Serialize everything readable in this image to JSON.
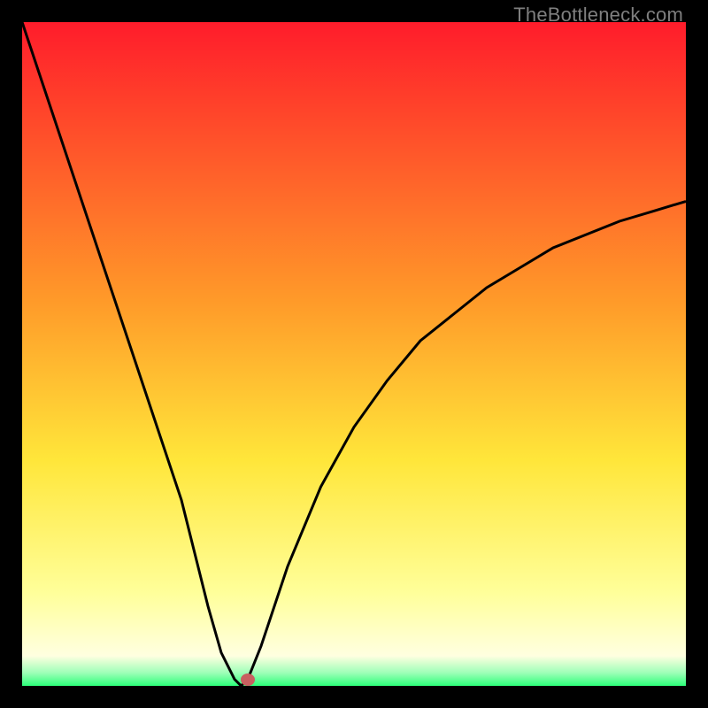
{
  "watermark": {
    "text": "TheBottleneck.com"
  },
  "colors": {
    "top": "#ff1c2b",
    "mid_orange": "#ff9a29",
    "yellow": "#ffe63a",
    "pale_yellow": "#ffff9a",
    "green": "#2cff7a",
    "curve": "#000000",
    "marker": "#c86060",
    "frame": "#000000"
  },
  "chart_data": {
    "type": "line",
    "title": "",
    "xlabel": "",
    "ylabel": "",
    "xlim": [
      0,
      100
    ],
    "ylim": [
      0,
      100
    ],
    "grid": false,
    "legend": false,
    "comment": "V-shaped bottleneck curve. Minimum near x≈33, y≈0. Axes unlabeled; values are percentage estimates read from proportional position.",
    "series": [
      {
        "name": "bottleneck-curve",
        "x": [
          0,
          4,
          8,
          12,
          16,
          20,
          24,
          28,
          30,
          32,
          33,
          34,
          36,
          40,
          45,
          50,
          55,
          60,
          65,
          70,
          75,
          80,
          85,
          90,
          95,
          100
        ],
        "y": [
          100,
          88,
          76,
          64,
          52,
          40,
          28,
          12,
          5,
          1,
          0,
          1,
          6,
          18,
          30,
          39,
          46,
          52,
          56,
          60,
          63,
          66,
          68,
          70,
          71.5,
          73
        ]
      }
    ],
    "marker": {
      "x": 34,
      "y": 1
    },
    "background_gradient_stops": [
      {
        "pos": 0.0,
        "color": "#ff1c2b"
      },
      {
        "pos": 0.42,
        "color": "#ff9a29"
      },
      {
        "pos": 0.66,
        "color": "#ffe63a"
      },
      {
        "pos": 0.86,
        "color": "#ffff9a"
      },
      {
        "pos": 0.955,
        "color": "#ffffe0"
      },
      {
        "pos": 0.98,
        "color": "#9fffb8"
      },
      {
        "pos": 1.0,
        "color": "#2cff7a"
      }
    ]
  }
}
